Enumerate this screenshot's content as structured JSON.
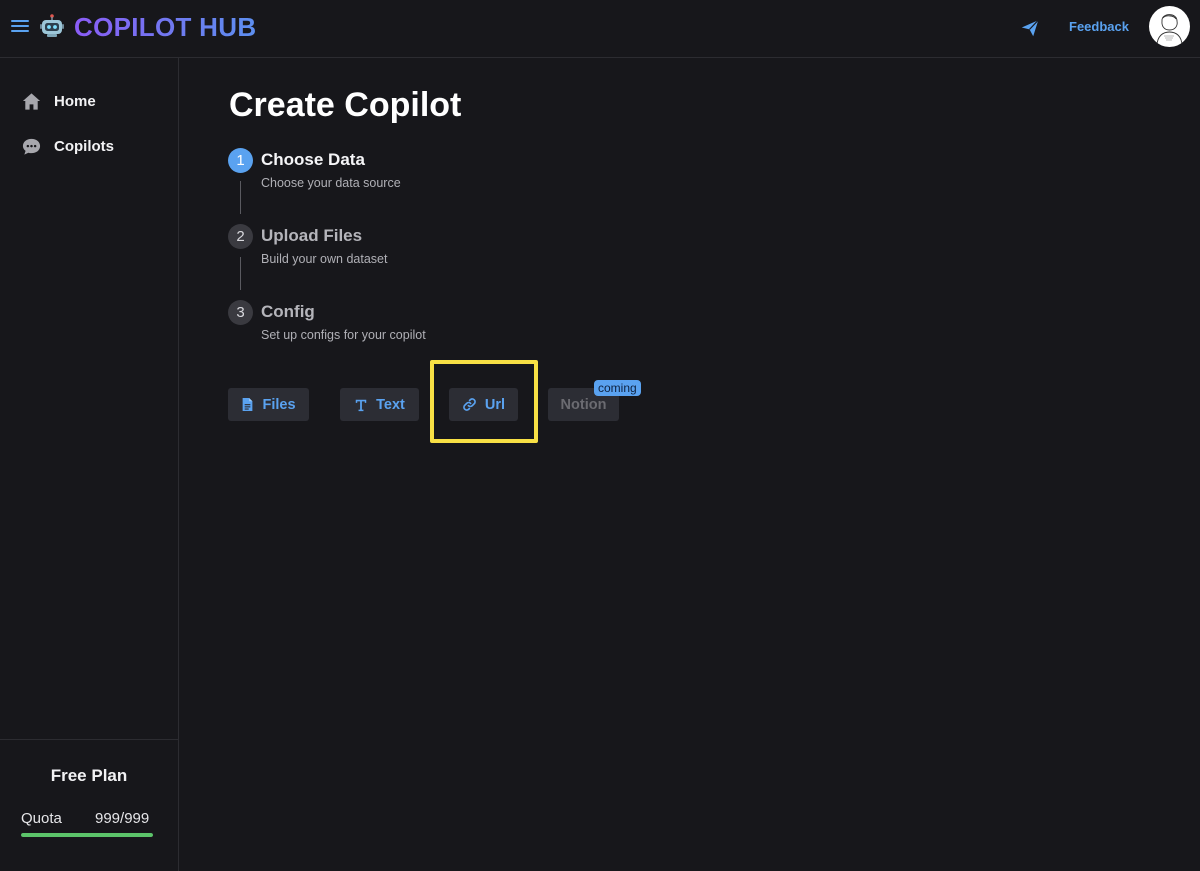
{
  "header": {
    "brand": "COPILOT HUB",
    "feedback_label": "Feedback"
  },
  "sidebar": {
    "items": [
      {
        "label": "Home",
        "icon": "home-icon"
      },
      {
        "label": "Copilots",
        "icon": "chat-bubble-icon"
      }
    ],
    "plan": {
      "title": "Free Plan",
      "quota_label": "Quota",
      "quota_value": "999/999",
      "quota_fraction": 1.0,
      "bar_color": "#5cc46a"
    }
  },
  "main": {
    "title": "Create Copilot",
    "steps": [
      {
        "number": "1",
        "title": "Choose Data",
        "description": "Choose your data source",
        "active": true
      },
      {
        "number": "2",
        "title": "Upload Files",
        "description": "Build your own dataset",
        "active": false
      },
      {
        "number": "3",
        "title": "Config",
        "description": "Set up configs for your copilot",
        "active": false
      }
    ],
    "sources": [
      {
        "label": "Files",
        "icon": "file-icon",
        "enabled": true
      },
      {
        "label": "Text",
        "icon": "text-icon",
        "enabled": true
      },
      {
        "label": "Url",
        "icon": "link-icon",
        "enabled": true,
        "highlighted": true
      },
      {
        "label": "Notion",
        "enabled": false,
        "badge": "coming"
      }
    ]
  },
  "colors": {
    "background": "#17171b",
    "accent": "#5aa2f0",
    "highlight": "#f8e045",
    "brand_gradient_start": "#8b5cf6",
    "brand_gradient_end": "#5d8ff0"
  }
}
